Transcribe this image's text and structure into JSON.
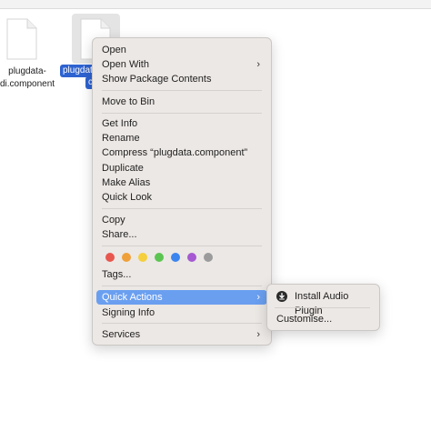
{
  "files": [
    {
      "name_line1": "plugdata-",
      "name_line2": "di.component"
    },
    {
      "name_line1": "plugdat",
      "name_line2": "c"
    }
  ],
  "menu": {
    "items": {
      "open": "Open",
      "open_with": "Open With",
      "show_package": "Show Package Contents",
      "move_to_bin": "Move to Bin",
      "get_info": "Get Info",
      "rename": "Rename",
      "compress": "Compress “plugdata.component”",
      "duplicate": "Duplicate",
      "make_alias": "Make Alias",
      "quick_look": "Quick Look",
      "copy": "Copy",
      "share": "Share...",
      "tags": "Tags...",
      "quick_actions": "Quick Actions",
      "signing_info": "Signing Info",
      "services": "Services"
    },
    "submenu_arrow": "›",
    "tag_colors": [
      "#e8574e",
      "#f0a03a",
      "#f5cf3d",
      "#5cc552",
      "#3b85ef",
      "#a659d2",
      "#9b9b9b"
    ]
  },
  "submenu": {
    "install_audio_plugin": "Install Audio Plugin",
    "customise": "Customise..."
  }
}
